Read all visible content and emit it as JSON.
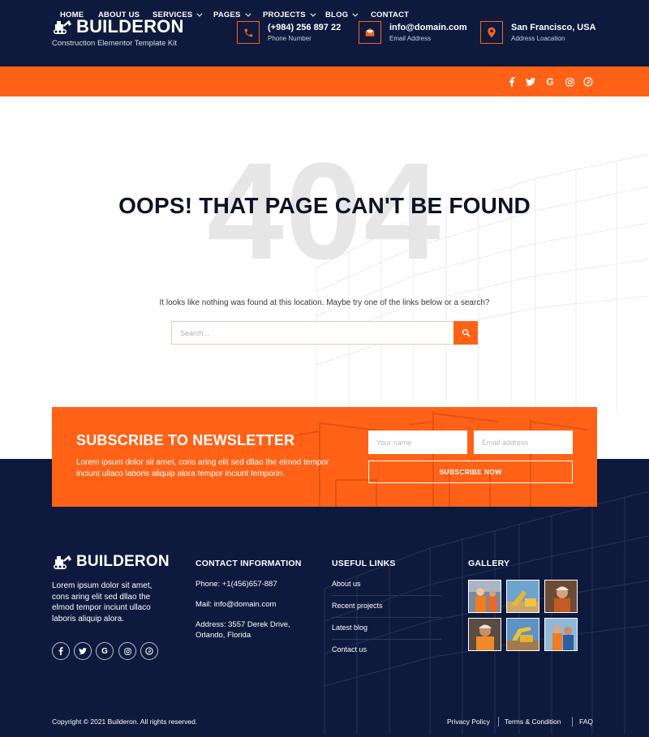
{
  "brand": {
    "name": "BUILDERON",
    "tagline": "Construction Elementor Template Kit"
  },
  "header_contacts": [
    {
      "icon": "phone-icon",
      "value": "(+984) 256 897 22",
      "label": "Phone Number"
    },
    {
      "icon": "email-icon",
      "value": "info@domain.com",
      "label": "Email Address"
    },
    {
      "icon": "location-pin-icon",
      "value": "San Francisco, USA",
      "label": "Address Loacation"
    }
  ],
  "nav": {
    "items": [
      {
        "label": "HOME",
        "dropdown": false
      },
      {
        "label": "ABOUT US",
        "dropdown": false
      },
      {
        "label": "SERVICES",
        "dropdown": true
      },
      {
        "label": "PAGES",
        "dropdown": true
      },
      {
        "label": "PROJECTS",
        "dropdown": true
      },
      {
        "label": "BLOG",
        "dropdown": true
      },
      {
        "label": "CONTACT",
        "dropdown": false
      }
    ],
    "social_icons": [
      "facebook-icon",
      "twitter-icon",
      "google-icon",
      "instagram-icon",
      "pinterest-icon"
    ]
  },
  "error": {
    "code": "404",
    "title": "OOPS! THAT PAGE CAN'T BE FOUND",
    "message": "It looks like nothing was found at this location. Maybe try one of the links below or a search?",
    "search_placeholder": "Search...",
    "search_value": ""
  },
  "newsletter": {
    "title": "SUBSCRIBE TO NEWSLETTER",
    "description": "Lorem ipsum dolor sit amet, cons aring elit sed dllao the elmod tempor inciunt ullaco laboris aliquip alora tempor inciunt temporin.",
    "name_placeholder": "Your name",
    "email_placeholder": "Email address",
    "button_label": "SUBSCRIBE NOW"
  },
  "footer": {
    "about": "Lorem ipsum dolor sit amet, cons aring elit sed dllao the elmod tempor inciunt ullaco laboris aliquip alora.",
    "contact_heading": "CONTACT INFORMATION",
    "phone": "Phone: +1(456)657-887",
    "mail": "Mail: info@domain.com",
    "address": "Address: 3557 Derek Drive, Orlando, Florida",
    "links_heading": "USEFUL LINKS",
    "links": [
      "About us",
      "Recent projects",
      "Latest blog",
      "Contact us"
    ],
    "gallery_heading": "GALLERY",
    "copyright": "Copyright © 2021 Builderon. All rights reserved.",
    "bottom_links": [
      "Privacy Policy",
      "Terms & Condition",
      "FAQ"
    ]
  },
  "colors": {
    "navy": "#0e1a3d",
    "orange": "#ff6217"
  }
}
